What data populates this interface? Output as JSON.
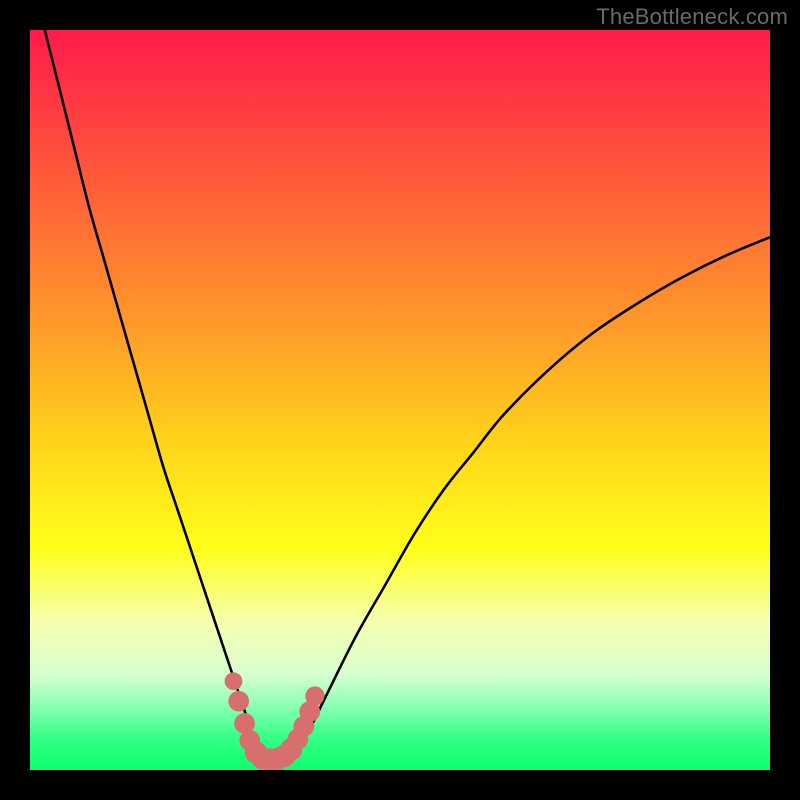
{
  "watermark": {
    "text": "TheBottleneck.com"
  },
  "colors": {
    "page_bg": "#000000",
    "curve_stroke": "#000000",
    "marker_fill": "#d76f6f",
    "gradient_stops": [
      {
        "offset": 0.0,
        "color": "#ff1a4b"
      },
      {
        "offset": 0.2,
        "color": "#ff5a3a"
      },
      {
        "offset": 0.4,
        "color": "#ff9a2a"
      },
      {
        "offset": 0.55,
        "color": "#ffd11a"
      },
      {
        "offset": 0.7,
        "color": "#ffff1a"
      },
      {
        "offset": 0.8,
        "color": "#f6ffb0"
      },
      {
        "offset": 0.87,
        "color": "#d8ffd0"
      },
      {
        "offset": 0.92,
        "color": "#7dffb0"
      },
      {
        "offset": 0.96,
        "color": "#2fff84"
      },
      {
        "offset": 1.0,
        "color": "#0cff6e"
      }
    ]
  },
  "chart_data": {
    "type": "line",
    "title": "",
    "xlabel": "",
    "ylabel": "",
    "xlim": [
      0,
      100
    ],
    "ylim": [
      0,
      100
    ],
    "series": [
      {
        "name": "bottleneck-curve",
        "x": [
          2,
          4,
          6,
          8,
          10,
          12,
          14,
          16,
          18,
          20,
          22,
          24,
          26,
          27,
          28,
          29,
          30,
          31,
          32,
          33,
          34,
          35,
          36,
          38,
          40,
          44,
          48,
          52,
          56,
          60,
          64,
          70,
          76,
          82,
          88,
          94,
          100
        ],
        "y": [
          100,
          92,
          84,
          76,
          69,
          62,
          55,
          48,
          41,
          35,
          29,
          23,
          17,
          14,
          11,
          8,
          5,
          3,
          2,
          1.5,
          1.5,
          2,
          3,
          6,
          10,
          18,
          25,
          32,
          38,
          43,
          48,
          54,
          59,
          63,
          66.5,
          69.5,
          72
        ]
      }
    ],
    "markers": {
      "name": "highlight-minimum",
      "points": [
        {
          "x": 27.5,
          "y": 12,
          "r": 1.2
        },
        {
          "x": 28.2,
          "y": 9.3,
          "r": 1.4
        },
        {
          "x": 29.0,
          "y": 6.3,
          "r": 1.4
        },
        {
          "x": 29.7,
          "y": 4.0,
          "r": 1.4
        },
        {
          "x": 30.5,
          "y": 2.4,
          "r": 1.5
        },
        {
          "x": 31.4,
          "y": 1.6,
          "r": 1.5
        },
        {
          "x": 32.4,
          "y": 1.4,
          "r": 1.5
        },
        {
          "x": 33.4,
          "y": 1.5,
          "r": 1.5
        },
        {
          "x": 34.4,
          "y": 1.9,
          "r": 1.5
        },
        {
          "x": 35.3,
          "y": 2.8,
          "r": 1.5
        },
        {
          "x": 36.2,
          "y": 4.2,
          "r": 1.4
        },
        {
          "x": 37.0,
          "y": 5.9,
          "r": 1.4
        },
        {
          "x": 37.8,
          "y": 7.9,
          "r": 1.4
        },
        {
          "x": 38.5,
          "y": 10.0,
          "r": 1.3
        }
      ]
    }
  }
}
